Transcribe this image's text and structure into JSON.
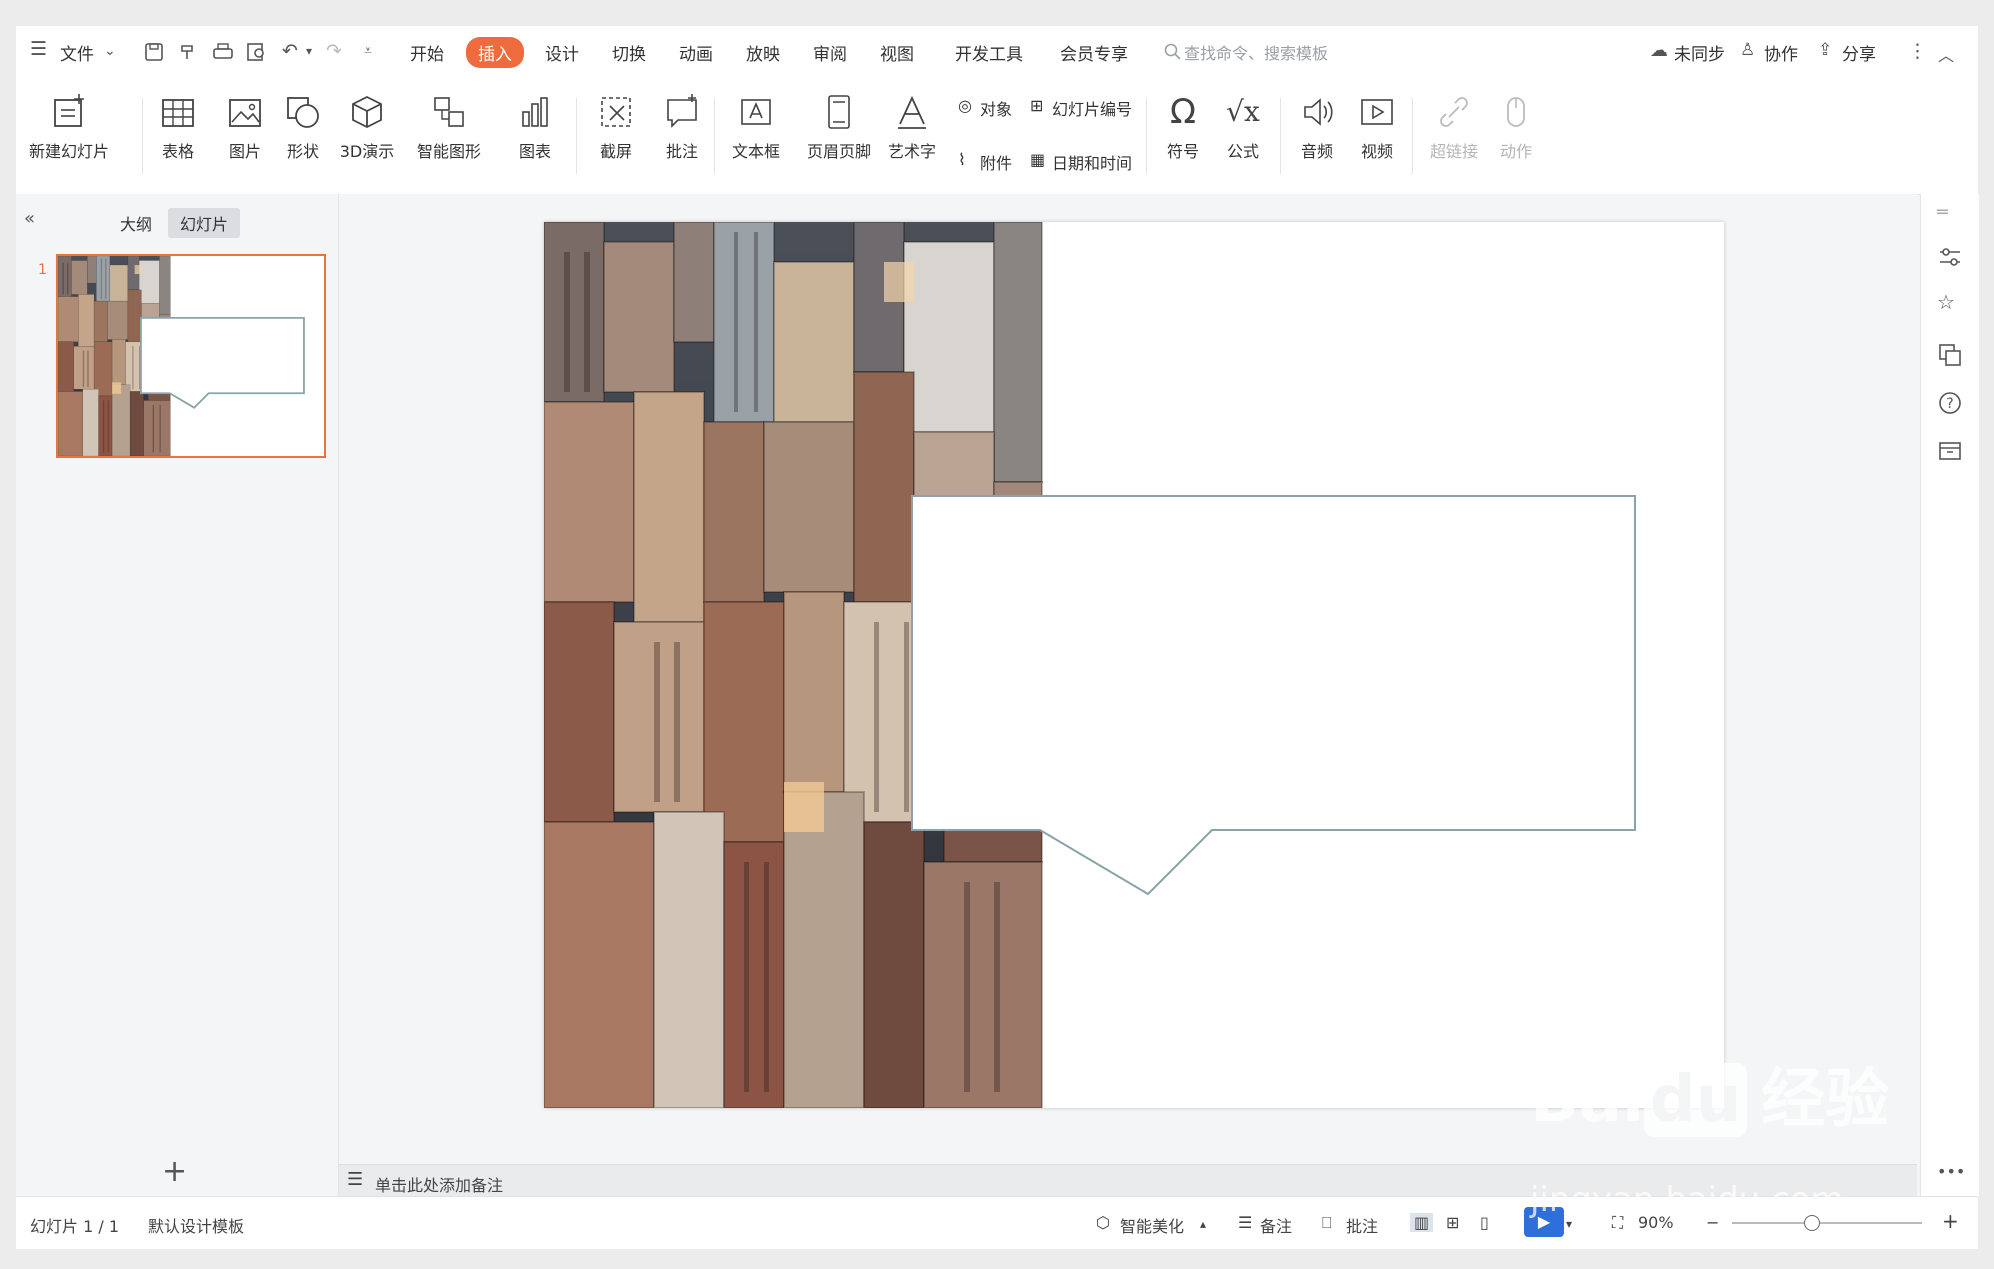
{
  "menu": {
    "file": "文件",
    "tabs": [
      "开始",
      "插入",
      "设计",
      "切换",
      "动画",
      "放映",
      "审阅",
      "视图",
      "开发工具",
      "会员专享"
    ],
    "active_tab": "插入",
    "search_placeholder": "查找命令、搜索模板",
    "sync": "未同步",
    "collab": "协作",
    "share": "分享"
  },
  "ribbon": {
    "new_slide": "新建幻灯片",
    "table": "表格",
    "picture": "图片",
    "shape": "形状",
    "threed": "3D演示",
    "smartart": "智能图形",
    "chart": "图表",
    "screenshot": "截屏",
    "comment": "批注",
    "textbox": "文本框",
    "header_footer": "页眉页脚",
    "wordart": "艺术字",
    "object": "对象",
    "slide_number": "幻灯片编号",
    "attachment": "附件",
    "datetime": "日期和时间",
    "symbol": "符号",
    "formula": "公式",
    "audio": "音频",
    "video": "视频",
    "hyperlink": "超链接",
    "action": "动作"
  },
  "left_panel": {
    "outline_tab": "大纲",
    "slides_tab": "幻灯片",
    "slide_index": "1",
    "add": "+"
  },
  "notes_placeholder": "单击此处添加备注",
  "status": {
    "slide_counter": "幻灯片 1 / 1",
    "template": "默认设计模板",
    "beautify": "智能美化",
    "notes": "备注",
    "comment": "批注",
    "zoom": "90%"
  },
  "watermark": {
    "brand": "Bai",
    "brand2": "du",
    "cn": "经验",
    "url": "jingyan.baidu.com"
  },
  "colors": {
    "accent": "#ee6b3d",
    "thumb_border": "#e8743b",
    "callout_stroke": "#8aa3a8"
  }
}
